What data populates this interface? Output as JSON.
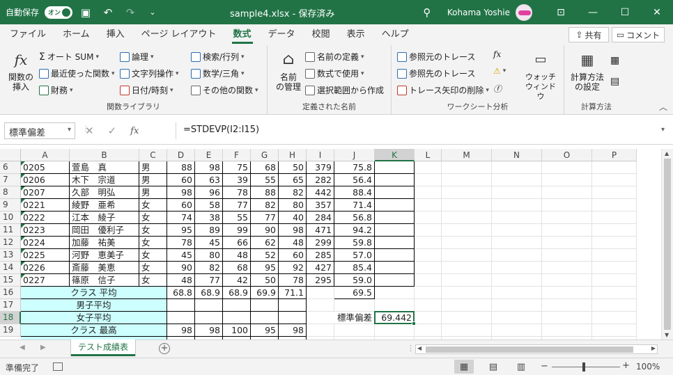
{
  "titlebar": {
    "autosave_label": "自動保存",
    "autosave_state": "オン",
    "title": "sample4.xlsx - 保存済み",
    "user": "Kohama Yoshie"
  },
  "menu": {
    "items": [
      "ファイル",
      "ホーム",
      "挿入",
      "ページ レイアウト",
      "数式",
      "データ",
      "校閲",
      "表示",
      "ヘルプ"
    ],
    "active": "数式",
    "share": "共有",
    "comment": "コメント"
  },
  "ribbon": {
    "insert_function_l1": "関数の",
    "insert_function_l2": "挿入",
    "autosum": "オート SUM",
    "recent": "最近使った関数",
    "financial": "財務",
    "logical": "論理",
    "text": "文字列操作",
    "datetime": "日付/時刻",
    "lookup": "検索/行列",
    "math": "数学/三角",
    "more": "その他の関数",
    "group1_label": "関数ライブラリ",
    "name_manager_l1": "名前",
    "name_manager_l2": "の管理",
    "define_name": "名前の定義",
    "use_in_formula": "数式で使用",
    "create_from_selection": "選択範囲から作成",
    "group2_label": "定義された名前",
    "trace_precedents": "参照元のトレース",
    "trace_dependents": "参照先のトレース",
    "remove_arrows": "トレース矢印の削除",
    "watch_l1": "ウォッチ",
    "watch_l2": "ウィンドウ",
    "group3_label": "ワークシート分析",
    "calc_options_l1": "計算方法",
    "calc_options_l2": "の設定",
    "group4_label": "計算方法"
  },
  "formulabar": {
    "namebox": "標準偏差",
    "formula": "=STDEVP(I2:I15)"
  },
  "columns": [
    "A",
    "B",
    "C",
    "D",
    "E",
    "F",
    "G",
    "H",
    "I",
    "J",
    "K",
    "L",
    "M",
    "N",
    "O",
    "P"
  ],
  "selected_column": "K",
  "rows": [
    {
      "n": "6",
      "a": "0205",
      "b": "萱島　真",
      "c": "男",
      "d": "88",
      "e": "98",
      "f": "75",
      "g": "68",
      "h": "50",
      "i": "379",
      "j": "75.8"
    },
    {
      "n": "7",
      "a": "0206",
      "b": "木下　宗道",
      "c": "男",
      "d": "60",
      "e": "63",
      "f": "39",
      "g": "55",
      "h": "65",
      "i": "282",
      "j": "56.4"
    },
    {
      "n": "8",
      "a": "0207",
      "b": "久部　明弘",
      "c": "男",
      "d": "98",
      "e": "96",
      "f": "78",
      "g": "88",
      "h": "82",
      "i": "442",
      "j": "88.4"
    },
    {
      "n": "9",
      "a": "0221",
      "b": "綾野　亜希",
      "c": "女",
      "d": "60",
      "e": "58",
      "f": "77",
      "g": "82",
      "h": "80",
      "i": "357",
      "j": "71.4"
    },
    {
      "n": "10",
      "a": "0222",
      "b": "江本　綾子",
      "c": "女",
      "d": "74",
      "e": "38",
      "f": "55",
      "g": "77",
      "h": "40",
      "i": "284",
      "j": "56.8"
    },
    {
      "n": "11",
      "a": "0223",
      "b": "岡田　優利子",
      "c": "女",
      "d": "95",
      "e": "89",
      "f": "99",
      "g": "90",
      "h": "98",
      "i": "471",
      "j": "94.2"
    },
    {
      "n": "12",
      "a": "0224",
      "b": "加藤　祐美",
      "c": "女",
      "d": "78",
      "e": "45",
      "f": "66",
      "g": "62",
      "h": "48",
      "i": "299",
      "j": "59.8"
    },
    {
      "n": "13",
      "a": "0225",
      "b": "河野　恵美子",
      "c": "女",
      "d": "45",
      "e": "80",
      "f": "48",
      "g": "52",
      "h": "60",
      "i": "285",
      "j": "57.0"
    },
    {
      "n": "14",
      "a": "0226",
      "b": "斎藤　美恵",
      "c": "女",
      "d": "90",
      "e": "82",
      "f": "68",
      "g": "95",
      "h": "92",
      "i": "427",
      "j": "85.4"
    },
    {
      "n": "15",
      "a": "0227",
      "b": "篠原　信子",
      "c": "女",
      "d": "48",
      "e": "77",
      "f": "42",
      "g": "50",
      "h": "78",
      "i": "295",
      "j": "59.0"
    }
  ],
  "summary": {
    "r16": {
      "n": "16",
      "label": "クラス 平均",
      "d": "68.8",
      "e": "68.9",
      "f": "68.9",
      "g": "69.9",
      "h": "71.1",
      "j": "69.5"
    },
    "r17": {
      "n": "17",
      "label": "男子平均"
    },
    "r18": {
      "n": "18",
      "label": "女子平均",
      "stdev_label": "標準偏差",
      "stdev_value": "69.442"
    },
    "r19": {
      "n": "19",
      "label": "クラス 最高",
      "d": "98",
      "e": "98",
      "f": "100",
      "g": "95",
      "h": "98"
    }
  },
  "sheet": {
    "tab": "テスト成績表"
  },
  "status": {
    "text": "準備完了",
    "zoom": "100%"
  },
  "colors": {
    "accent": "#217346",
    "summary_fill": "#ccfffe"
  }
}
